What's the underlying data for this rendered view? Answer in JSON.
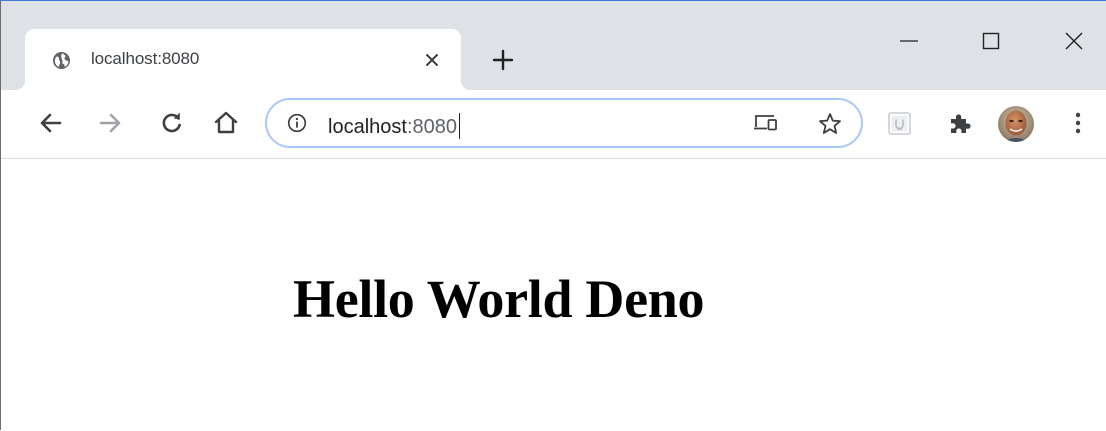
{
  "browser": {
    "tab": {
      "title": "localhost:8080",
      "favicon": "globe-icon"
    },
    "new_tab_icon": "plus-icon",
    "window_controls": [
      "minimize-icon",
      "maximize-icon",
      "close-icon"
    ],
    "toolbar": {
      "icons": [
        "back-arrow-icon",
        "forward-arrow-icon",
        "reload-icon",
        "home-icon"
      ]
    },
    "omnibox": {
      "info_icon": "info-icon",
      "url_host": "localhost",
      "url_port": ":8080",
      "right_icons": [
        "cast-icon",
        "star-icon"
      ]
    },
    "extensions": [
      "extension-icon",
      "extensions-puzzle-icon"
    ],
    "profile": "avatar",
    "menu_icon": "kebab-menu-icon"
  },
  "page": {
    "heading": "Hello World Deno"
  },
  "colors": {
    "tabstrip_bg": "#dee1e6",
    "omnibox_focus_ring": "#a8c7fa",
    "icon_gray": "#5f6368",
    "disabled_icon": "#a0a4a8"
  }
}
